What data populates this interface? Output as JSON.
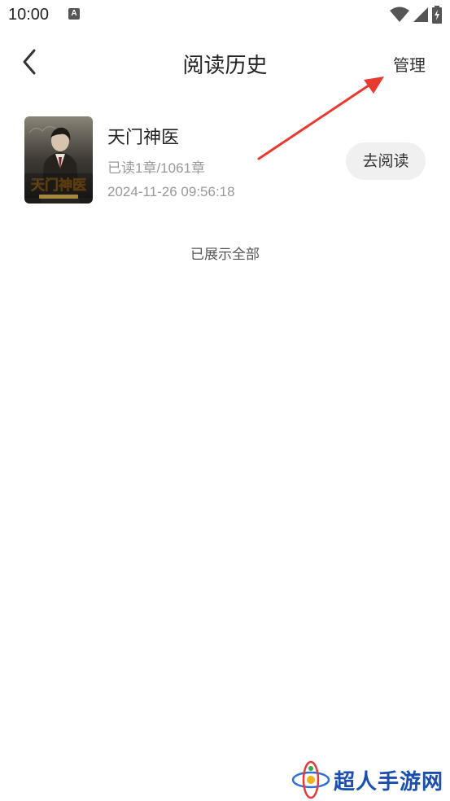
{
  "status_bar": {
    "time": "10:00",
    "notification_icon_letter": "A",
    "icons": [
      "wifi-icon",
      "signal-icon",
      "battery-icon"
    ]
  },
  "nav": {
    "back_icon": "chevron-left-icon",
    "title": "阅读历史",
    "manage_label": "管理"
  },
  "history": {
    "items": [
      {
        "title": "天门神医",
        "progress": "已读1章/1061章",
        "time": "2024-11-26 09:56:18",
        "action_label": "去阅读",
        "cover_text": "天门神医"
      }
    ],
    "footer": "已展示全部"
  },
  "watermark": {
    "text": "超人手游网"
  },
  "colors": {
    "accent_arrow": "#e83a2e",
    "text_primary": "#222222",
    "text_secondary": "#999999",
    "button_bg": "#f0f0f0",
    "watermark_blue": "#1a4fb0"
  }
}
